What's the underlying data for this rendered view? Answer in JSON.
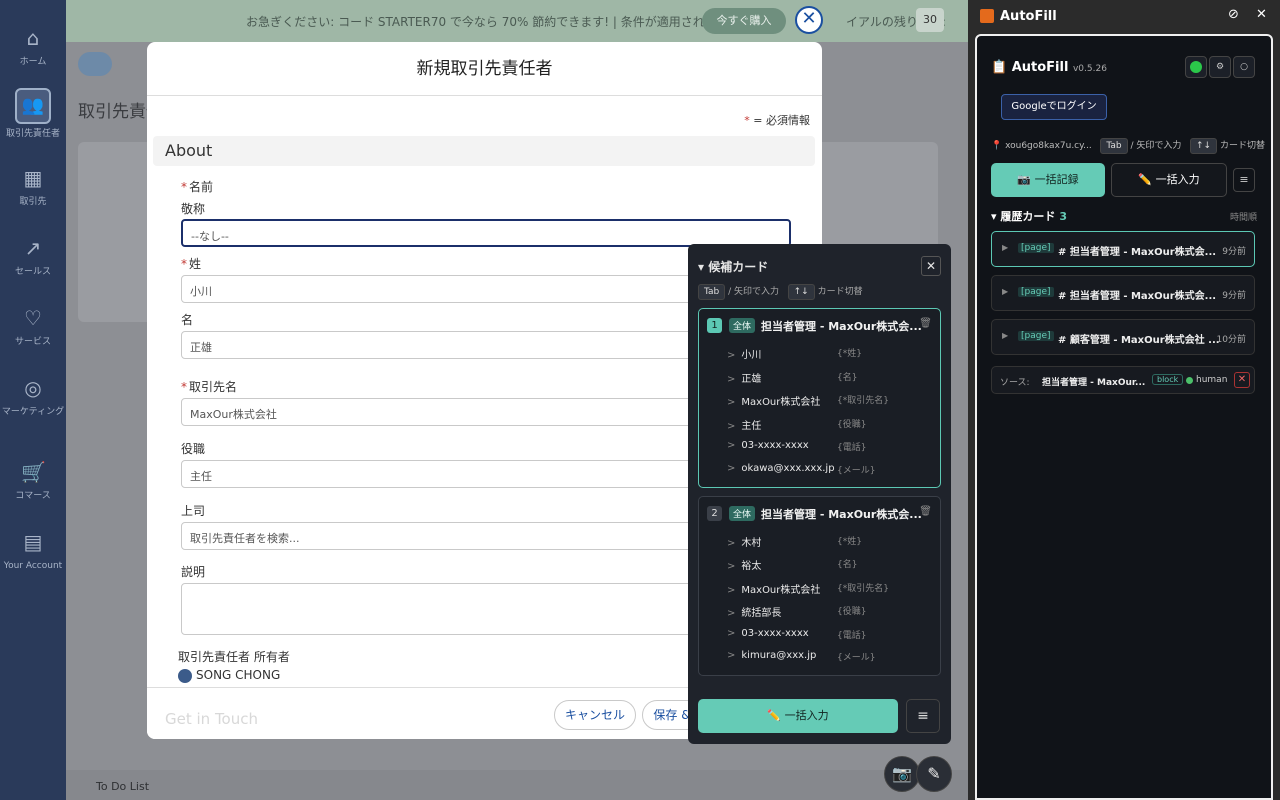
{
  "banner": {
    "text": "お急ぎください: コード STARTER70 で今なら 70% 節約できます! | 条件が適用されます。",
    "cta": "今すぐ購入",
    "remain_label": "イアルの残り日数:",
    "remain_days": "30"
  },
  "nav": [
    {
      "icon": "⌂",
      "label": "ホーム"
    },
    {
      "icon": "👥",
      "label": "取引先責任者"
    },
    {
      "icon": "▦",
      "label": "取引先"
    },
    {
      "icon": "↗",
      "label": "セールス"
    },
    {
      "icon": "♡",
      "label": "サービス"
    },
    {
      "icon": "◎",
      "label": "マーケティング"
    },
    {
      "icon": "🛒",
      "label": "コマース"
    },
    {
      "icon": "▤",
      "label": "Your Account"
    }
  ],
  "bg": {
    "title": "取引先責任",
    "todo": "To Do List"
  },
  "modal": {
    "title": "新規取引先責任者",
    "req_star": "*",
    "req_note": "= 必須情報",
    "section": "About",
    "name_label": "名前",
    "salutation_label": "敬称",
    "salutation_value": "--なし--",
    "last_label": "姓",
    "last_value": "小川",
    "first_label": "名",
    "first_value": "正雄",
    "account_label": "取引先名",
    "account_value": "MaxOur株式会社",
    "title_label": "役職",
    "title_value": "主任",
    "boss_label": "上司",
    "boss_placeholder": "取引先責任者を検索...",
    "desc_label": "説明",
    "owner_label": "取引先責任者 所有者",
    "owner_name": "SONG CHONG",
    "ghost": "Get in Touch",
    "cancel": "キャンセル",
    "save": "保存 &"
  },
  "cand": {
    "title": "▾ 候補カード",
    "kbd_tab": "Tab",
    "hint_tab": "/ 矢印で入力",
    "kbd_arrows": "↑↓",
    "hint_arrows": "カード切替",
    "cards": [
      {
        "num": "1",
        "tag": "全体",
        "title": "担当者管理 - MaxOur株式会...",
        "fields": [
          {
            "v": "小川",
            "k": "{*姓}"
          },
          {
            "v": "正雄",
            "k": "{名}"
          },
          {
            "v": "MaxOur株式会社",
            "k": "{*取引先名}"
          },
          {
            "v": "主任",
            "k": "{役職}"
          },
          {
            "v": "03-xxxx-xxxx",
            "k": "{電話}"
          },
          {
            "v": "okawa@xxx.xxx.jp",
            "k": "{メール}"
          }
        ]
      },
      {
        "num": "2",
        "tag": "全体",
        "title": "担当者管理 - MaxOur株式会...",
        "fields": [
          {
            "v": "木村",
            "k": "{*姓}"
          },
          {
            "v": "裕太",
            "k": "{名}"
          },
          {
            "v": "MaxOur株式会社",
            "k": "{*取引先名}"
          },
          {
            "v": "統括部長",
            "k": "{役職}"
          },
          {
            "v": "03-xxxx-xxxx",
            "k": "{電話}"
          },
          {
            "v": "kimura@xxx.jp",
            "k": "{メール}"
          }
        ]
      }
    ],
    "bulk": "✏️ 一括入力",
    "menu": "≡"
  },
  "af": {
    "app": "AutoFill",
    "brand": "📋 AutoFill",
    "version": "v0.5.26",
    "login": "Googleでログイン",
    "site": "📍 xou6go8kax7u.cy...",
    "kbd_tab": "Tab",
    "hint_tab": "/ 矢印で入力",
    "kbd_arrows": "↑↓",
    "hint_arrows": "カード切替",
    "rec": "📷 一括記録",
    "inp": "✏️ 一括入力",
    "menu": "≡",
    "hist_label": "▾ 履歴カード",
    "hist_count": "3",
    "order": "時間順",
    "history": [
      {
        "tag": "[page]",
        "title": "# 担当者管理 - MaxOur株式会...",
        "time": "9分前"
      },
      {
        "tag": "[page]",
        "title": "# 担当者管理 - MaxOur株式会...",
        "time": "9分前"
      },
      {
        "tag": "[page]",
        "title": "# 顧客管理 - MaxOur株式会社 ...",
        "time": "10分前"
      }
    ],
    "src_label": "ソース:",
    "src_title": "担当者管理 - MaxOur...",
    "src_block": "block",
    "src_human": "human",
    "src_del": "✕"
  }
}
